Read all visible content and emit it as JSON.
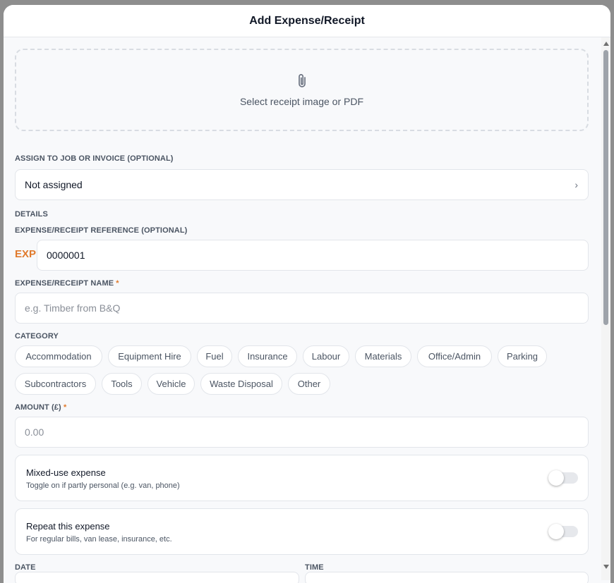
{
  "modal": {
    "title": "Add Expense/Receipt"
  },
  "upload": {
    "icon": "paperclip-icon",
    "label": "Select receipt image or PDF"
  },
  "assign": {
    "label": "ASSIGN TO JOB OR INVOICE (OPTIONAL)",
    "value": "Not assigned",
    "chevron": "›"
  },
  "details": {
    "section_label": "DETAILS"
  },
  "reference": {
    "label": "EXPENSE/RECEIPT REFERENCE (OPTIONAL)",
    "prefix": "EXP",
    "value": "0000001"
  },
  "name": {
    "label": "EXPENSE/RECEIPT NAME",
    "required_mark": "*",
    "placeholder": "e.g. Timber from B&Q"
  },
  "category": {
    "label": "CATEGORY",
    "options": [
      "Accommodation",
      "Equipment Hire",
      "Fuel",
      "Insurance",
      "Labour",
      "Materials",
      "Office/Admin",
      "Parking",
      "Subcontractors",
      "Tools",
      "Vehicle",
      "Waste Disposal",
      "Other"
    ]
  },
  "amount": {
    "label": "AMOUNT (£)",
    "required_mark": "*",
    "placeholder": "0.00"
  },
  "mixed_use": {
    "title": "Mixed-use expense",
    "subtitle": "Toggle on if partly personal (e.g. van, phone)",
    "enabled": false
  },
  "repeat": {
    "title": "Repeat this expense",
    "subtitle": "For regular bills, van lease, insurance, etc.",
    "enabled": false
  },
  "date": {
    "label": "DATE"
  },
  "time": {
    "label": "TIME"
  },
  "colors": {
    "accent": "#e07a2c",
    "text": "#111827",
    "muted": "#4b5563",
    "border": "#e2e5ea"
  }
}
